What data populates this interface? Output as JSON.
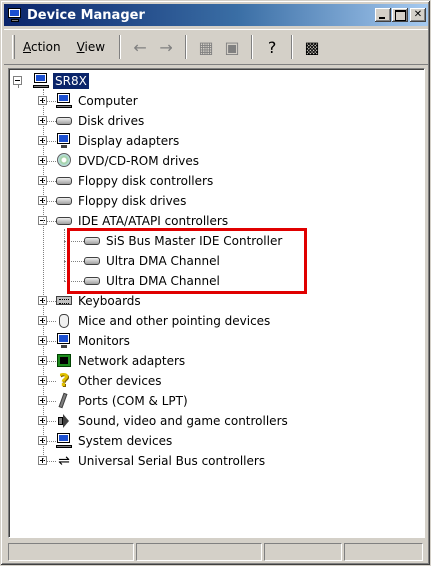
{
  "window": {
    "title": "Device Manager"
  },
  "menu": [
    {
      "label": "Action"
    },
    {
      "label": "View"
    }
  ],
  "toolbar": {
    "buttons": [
      {
        "icon": "back-arrow-icon",
        "glyph": "←",
        "enabled": false
      },
      {
        "icon": "forward-arrow-icon",
        "glyph": "→",
        "enabled": false
      },
      {
        "icon": "list-view-icon",
        "glyph": "▦",
        "enabled": false
      },
      {
        "icon": "properties-icon",
        "glyph": "▣",
        "enabled": false
      },
      {
        "icon": "help-icon",
        "glyph": "?",
        "enabled": true
      },
      {
        "icon": "scan-hardware-icon",
        "glyph": "▩",
        "enabled": true
      }
    ]
  },
  "tree": {
    "root": {
      "label": "SR8X",
      "selected": true
    },
    "categories": [
      {
        "label": "Computer",
        "icon": "computer",
        "expanded": false
      },
      {
        "label": "Disk drives",
        "icon": "drive",
        "expanded": false
      },
      {
        "label": "Display adapters",
        "icon": "display",
        "expanded": false
      },
      {
        "label": "DVD/CD-ROM drives",
        "icon": "cd",
        "expanded": false
      },
      {
        "label": "Floppy disk controllers",
        "icon": "drive",
        "expanded": false
      },
      {
        "label": "Floppy disk drives",
        "icon": "drive",
        "expanded": false
      },
      {
        "label": "IDE ATA/ATAPI controllers",
        "icon": "drive",
        "expanded": true,
        "children": [
          {
            "label": "SiS Bus Master IDE Controller"
          },
          {
            "label": "Ultra DMA Channel"
          },
          {
            "label": "Ultra DMA Channel"
          }
        ]
      },
      {
        "label": "Keyboards",
        "icon": "kbd",
        "expanded": false
      },
      {
        "label": "Mice and other pointing devices",
        "icon": "mouse",
        "expanded": false
      },
      {
        "label": "Monitors",
        "icon": "display",
        "expanded": false
      },
      {
        "label": "Network adapters",
        "icon": "net",
        "expanded": false
      },
      {
        "label": "Other devices",
        "icon": "question",
        "expanded": false
      },
      {
        "label": "Ports (COM & LPT)",
        "icon": "port",
        "expanded": false
      },
      {
        "label": "Sound, video and game controllers",
        "icon": "sound",
        "expanded": false
      },
      {
        "label": "System devices",
        "icon": "computer",
        "expanded": false
      },
      {
        "label": "Universal Serial Bus controllers",
        "icon": "usb",
        "expanded": false
      }
    ]
  },
  "colors": {
    "highlight_border": "#e00000",
    "selection": "#0a246a",
    "titlebar": "#0a246a"
  }
}
